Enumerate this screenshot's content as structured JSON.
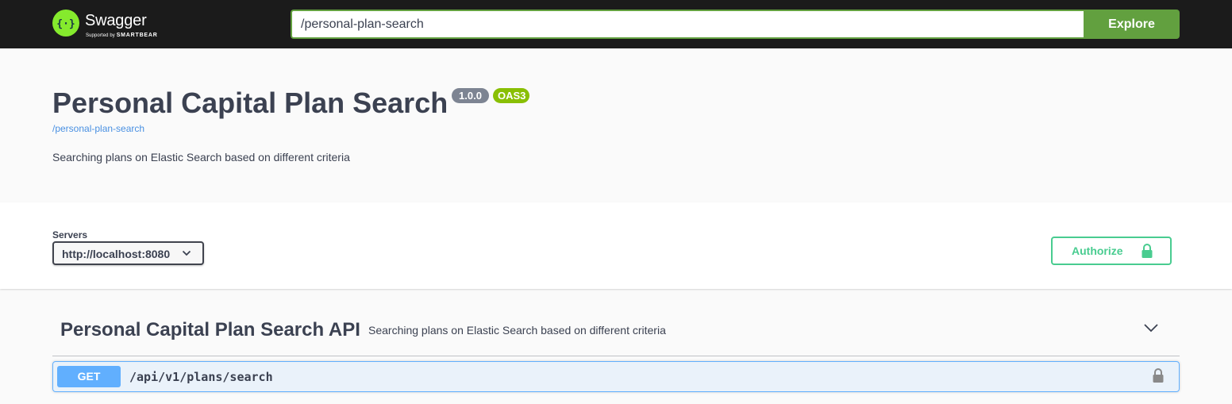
{
  "topbar": {
    "brand_name": "Swagger",
    "brand_sub_prefix": "Supported by",
    "brand_sub_company": "SMARTBEAR",
    "url_value": "/personal-plan-search",
    "explore_label": "Explore"
  },
  "info": {
    "title": "Personal Capital Plan Search",
    "version": "1.0.0",
    "oas_badge": "OAS3",
    "base_url": "/personal-plan-search",
    "description": "Searching plans on Elastic Search based on different criteria"
  },
  "servers": {
    "label": "Servers",
    "selected": "http://localhost:8080"
  },
  "authorize": {
    "label": "Authorize"
  },
  "tag": {
    "name": "Personal Capital Plan Search API",
    "description": "Searching plans on Elastic Search based on different criteria"
  },
  "operations": [
    {
      "method": "GET",
      "path": "/api/v1/plans/search"
    }
  ],
  "colors": {
    "topbar_bg": "#1b1b1b",
    "explore_green": "#62a03f",
    "get_blue": "#61affe",
    "authorize_green": "#49cc90",
    "version_badge": "#7d8492",
    "oas_badge": "#89bf04"
  }
}
